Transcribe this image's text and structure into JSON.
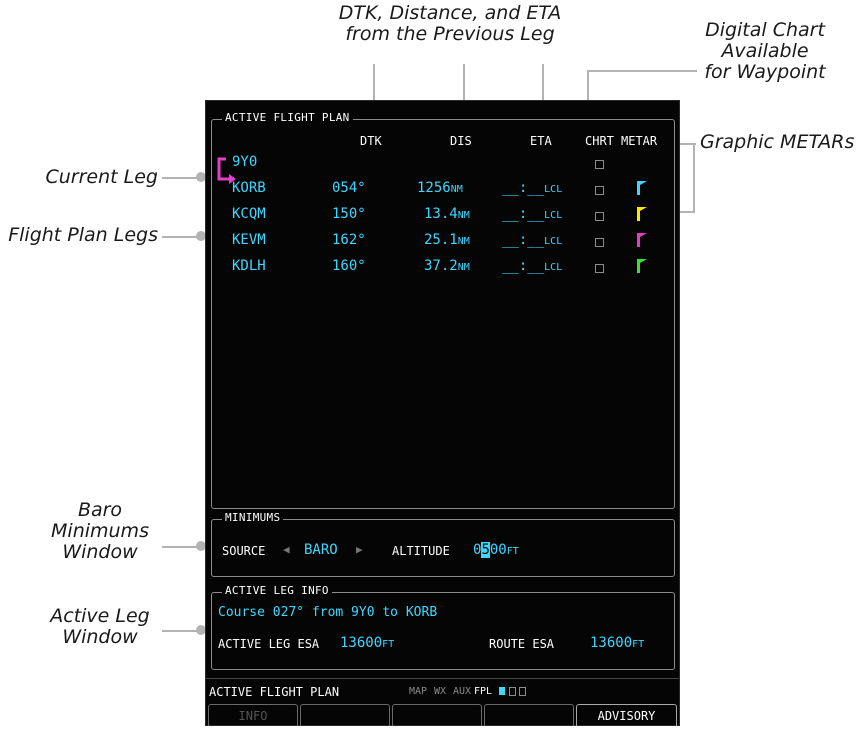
{
  "callouts": {
    "dtk_distance_eta": [
      "DTK, Distance, and ETA",
      "from the Previous Leg"
    ],
    "digital_chart": [
      "Digital Chart",
      "Available",
      "for Waypoint"
    ],
    "graphic_metars": "Graphic METARs",
    "current_leg": "Current Leg",
    "flight_plan_legs": "Flight Plan Legs",
    "baro_minimums": [
      "Baro",
      "Minimums",
      "Window"
    ],
    "active_leg_window": [
      "Active Leg",
      "Window"
    ]
  },
  "flight_plan": {
    "title": "ACTIVE FLIGHT PLAN",
    "headers": {
      "dtk": "DTK",
      "dis": "DIS",
      "eta": "ETA",
      "chrt": "CHRT",
      "metar": "METAR"
    },
    "rows": [
      {
        "wpt": "9Y0",
        "dtk": "",
        "dis": "",
        "dis_unit": "",
        "eta": "",
        "eta_unit": "",
        "metar_color": ""
      },
      {
        "wpt": "KORB",
        "dtk": "054°",
        "dis": "1256",
        "dis_unit": "NM",
        "eta": "__:__",
        "eta_unit": "LCL",
        "metar_color": "#3fd7ff"
      },
      {
        "wpt": "KCQM",
        "dtk": "150°",
        "dis": "13.4",
        "dis_unit": "NM",
        "eta": "__:__",
        "eta_unit": "LCL",
        "metar_color": "#ffe800"
      },
      {
        "wpt": "KEVM",
        "dtk": "162°",
        "dis": "25.1",
        "dis_unit": "NM",
        "eta": "__:__",
        "eta_unit": "LCL",
        "metar_color": "#e040c8"
      },
      {
        "wpt": "KDLH",
        "dtk": "160°",
        "dis": "37.2",
        "dis_unit": "NM",
        "eta": "__:__",
        "eta_unit": "LCL",
        "metar_color": "#38e038"
      }
    ],
    "current_leg_color": "#e040c8"
  },
  "minimums": {
    "title": "MINIMUMS",
    "source_label": "SOURCE",
    "source_value": "BARO",
    "altitude_label": "ALTITUDE",
    "altitude_pre": "0",
    "altitude_cursor": "5",
    "altitude_post": "00",
    "altitude_unit": "FT"
  },
  "active_leg": {
    "title": "ACTIVE LEG INFO",
    "course_text": "Course 027° from 9Y0 to KORB",
    "leg_esa_label": "ACTIVE LEG ESA",
    "leg_esa_value": "13600",
    "leg_esa_unit": "FT",
    "route_esa_label": "ROUTE ESA",
    "route_esa_value": "13600",
    "route_esa_unit": "FT"
  },
  "status_bar": {
    "page_name": "ACTIVE FLIGHT PLAN",
    "groups": [
      "MAP",
      "WX",
      "AUX"
    ],
    "active_group": "FPL"
  },
  "softkeys": [
    "INFO",
    "",
    "",
    "",
    "ADVISORY"
  ]
}
